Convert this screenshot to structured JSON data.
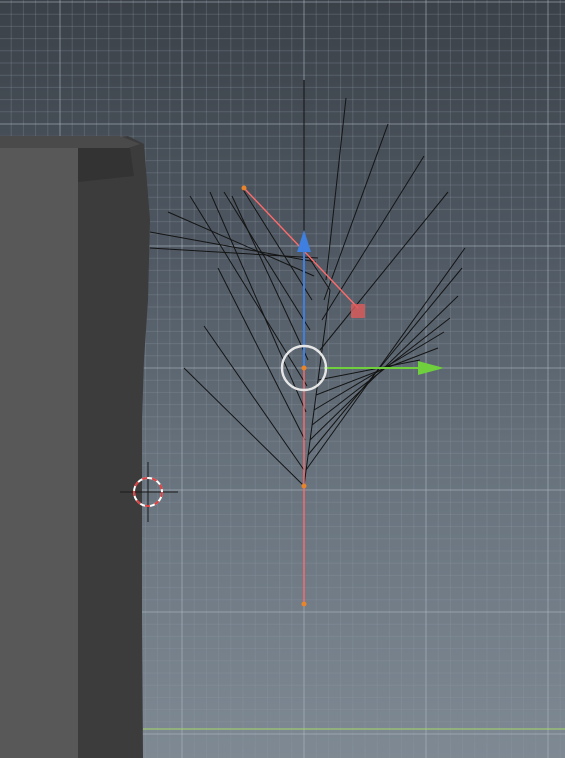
{
  "viewport": {
    "mode": "3d-viewport-orthographic",
    "background_top": "#3b4148",
    "background_bottom": "#7e8994",
    "grid_minor_color": "#8f9ba6",
    "grid_major_color": "#b3bec8",
    "x_axis_line_color": "#a8d86a"
  },
  "objects": {
    "wall": {
      "kind": "mesh-block",
      "face_color": "#585858",
      "side_color": "#3c3c3c"
    },
    "fern": {
      "kind": "wireframe-leaf",
      "line_color": "#141414",
      "vein_count_per_side": 10
    },
    "armature": {
      "kind": "bone-chain",
      "bone_color": "#ff6b6b",
      "joint_color": "#e8842b",
      "end_handle_color": "#e05a5a"
    },
    "cursor_3d": {
      "kind": "3d-cursor",
      "ring_colors": [
        "#e04040",
        "#ffffff"
      ]
    }
  },
  "gizmo": {
    "kind": "translate-gizmo",
    "x_axis_color": "#6fcf3d",
    "z_axis_color": "#3f7fe0",
    "pivot_ring_color": "#e6e6e6"
  }
}
